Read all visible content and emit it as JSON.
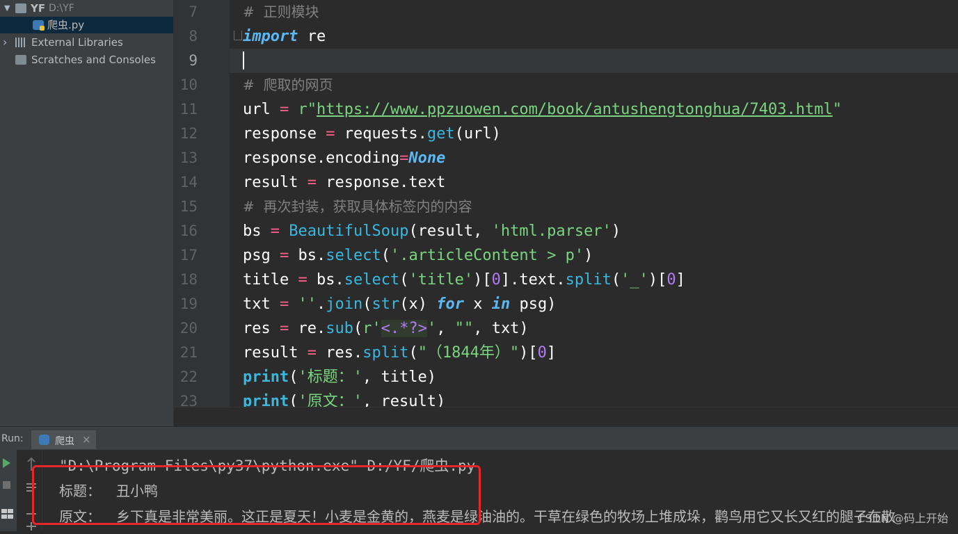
{
  "project_tree": {
    "root_name": "YF",
    "root_path": "D:\\YF",
    "file": "爬虫.py",
    "external_libraries": "External Libraries",
    "scratches": "Scratches and Consoles"
  },
  "editor": {
    "line_numbers": [
      "7",
      "8",
      "9",
      "10",
      "11",
      "12",
      "13",
      "14",
      "15",
      "16",
      "17",
      "18",
      "19",
      "20",
      "21",
      "22",
      "23"
    ],
    "current_line": "9",
    "code": {
      "l7_comment": "#  正则模块",
      "l8_kw": "import",
      "l8_rest": " re",
      "l10_comment": "#  爬取的网页",
      "l11_var": "url ",
      "l11_eq": "=",
      "l11_pre": " r\"",
      "l11_url": "https://www.ppzuowen.com/book/antushengtonghua/7403.html",
      "l11_end": "\"",
      "l12_var": "response ",
      "l12_eq": "=",
      "l12_mid": " requests.",
      "l12_fn": "get",
      "l12_end": "(url)",
      "l13_var": "response.encoding",
      "l13_eq": "=",
      "l13_kw": "None",
      "l14_var": "result ",
      "l14_eq": "=",
      "l14_end": " response.text",
      "l15_comment": "#  再次封装，获取具体标签内的内容",
      "l16_var": "bs ",
      "l16_eq": "=",
      "l16_sp": " ",
      "l16_fn": "BeautifulSoup",
      "l16_mid": "(result, ",
      "l16_str": "'html.parser'",
      "l16_end": ")",
      "l17_var": "psg ",
      "l17_eq": "=",
      "l17_mid": " bs.",
      "l17_fn": "select",
      "l17_p": "(",
      "l17_str": "'.articleContent > p'",
      "l17_end": ")",
      "l18_var": "title ",
      "l18_eq": "=",
      "l18_mid": " bs.",
      "l18_fn": "select",
      "l18_p": "(",
      "l18_str": "'title'",
      "l18_b": ")[",
      "l18_n": "0",
      "l18_c": "].text.",
      "l18_fn2": "split",
      "l18_p2": "(",
      "l18_str2": "'_'",
      "l18_d": ")[",
      "l18_n2": "0",
      "l18_end": "]",
      "l19_var": "txt ",
      "l19_eq": "=",
      "l19_sp": " ",
      "l19_str": "''",
      "l19_dot": ".",
      "l19_fn": "join",
      "l19_p": "(",
      "l19_fn2": "str",
      "l19_x": "(x) ",
      "l19_kw": "for",
      "l19_x2": " x ",
      "l19_kw2": "in",
      "l19_end": " psg)",
      "l20_var": "res ",
      "l20_eq": "=",
      "l20_mid": " re.",
      "l20_fn": "sub",
      "l20_p": "(",
      "l20_str": "r'",
      "l20_rx": "<.*?>",
      "l20_str2": "'",
      "l20_c": ", ",
      "l20_str3": "\"\"",
      "l20_end": ", txt)",
      "l21_var": "result ",
      "l21_eq": "=",
      "l21_mid": " res.",
      "l21_fn": "split",
      "l21_p": "(",
      "l21_str": "\"（1844年）\"",
      "l21_b": ")[",
      "l21_n": "0",
      "l21_end": "]",
      "l22_kw": "print",
      "l22_p": "(",
      "l22_str": "'标题：'",
      "l22_end": ", title)",
      "l23_kw": "print",
      "l23_p": "(",
      "l23_str": "'原文：'",
      "l23_end": ", result)"
    }
  },
  "run_panel": {
    "label": "Run:",
    "tab_name": "爬虫",
    "command": "\"D:\\Program Files\\py37\\python.exe\" D:/YF/爬虫.py",
    "output_title_label": "标题：",
    "output_title_value": "丑小鸭",
    "output_text_label": "原文：",
    "output_text_value": "乡下真是非常美丽。这正是夏天！小麦是金黄的，燕麦是绿油油的。干草在绿色的牧场上堆成垛，鹳鸟用它又长又红的腿子在散"
  },
  "watermark": "CSDN @码上开始"
}
